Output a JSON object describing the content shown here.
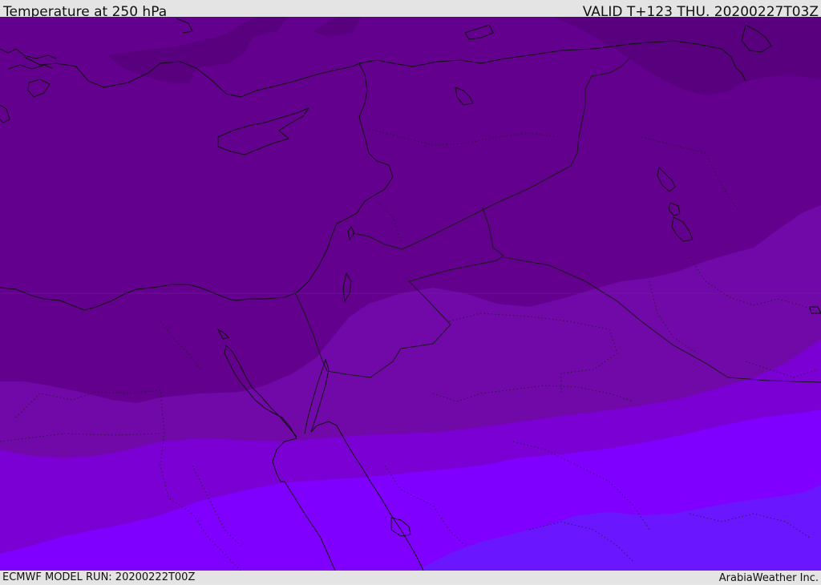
{
  "header": {
    "title": "Temperature at 250 hPa",
    "valid": "VALID T+123 THU. 20200227T03Z"
  },
  "footer": {
    "model_run": "ECMWF MODEL RUN: 20200222T00Z",
    "credit": "ArabiaWeather Inc."
  },
  "map": {
    "colors": {
      "band_darkest": "#58007d",
      "band_dark": "#64008e",
      "band_mid": "#7108a8",
      "band_violet": "#7a00d4",
      "band_bright": "#8000ff",
      "band_blue": "#6a16ff",
      "coastline": "#111111",
      "border": "#1a1a1a"
    }
  }
}
